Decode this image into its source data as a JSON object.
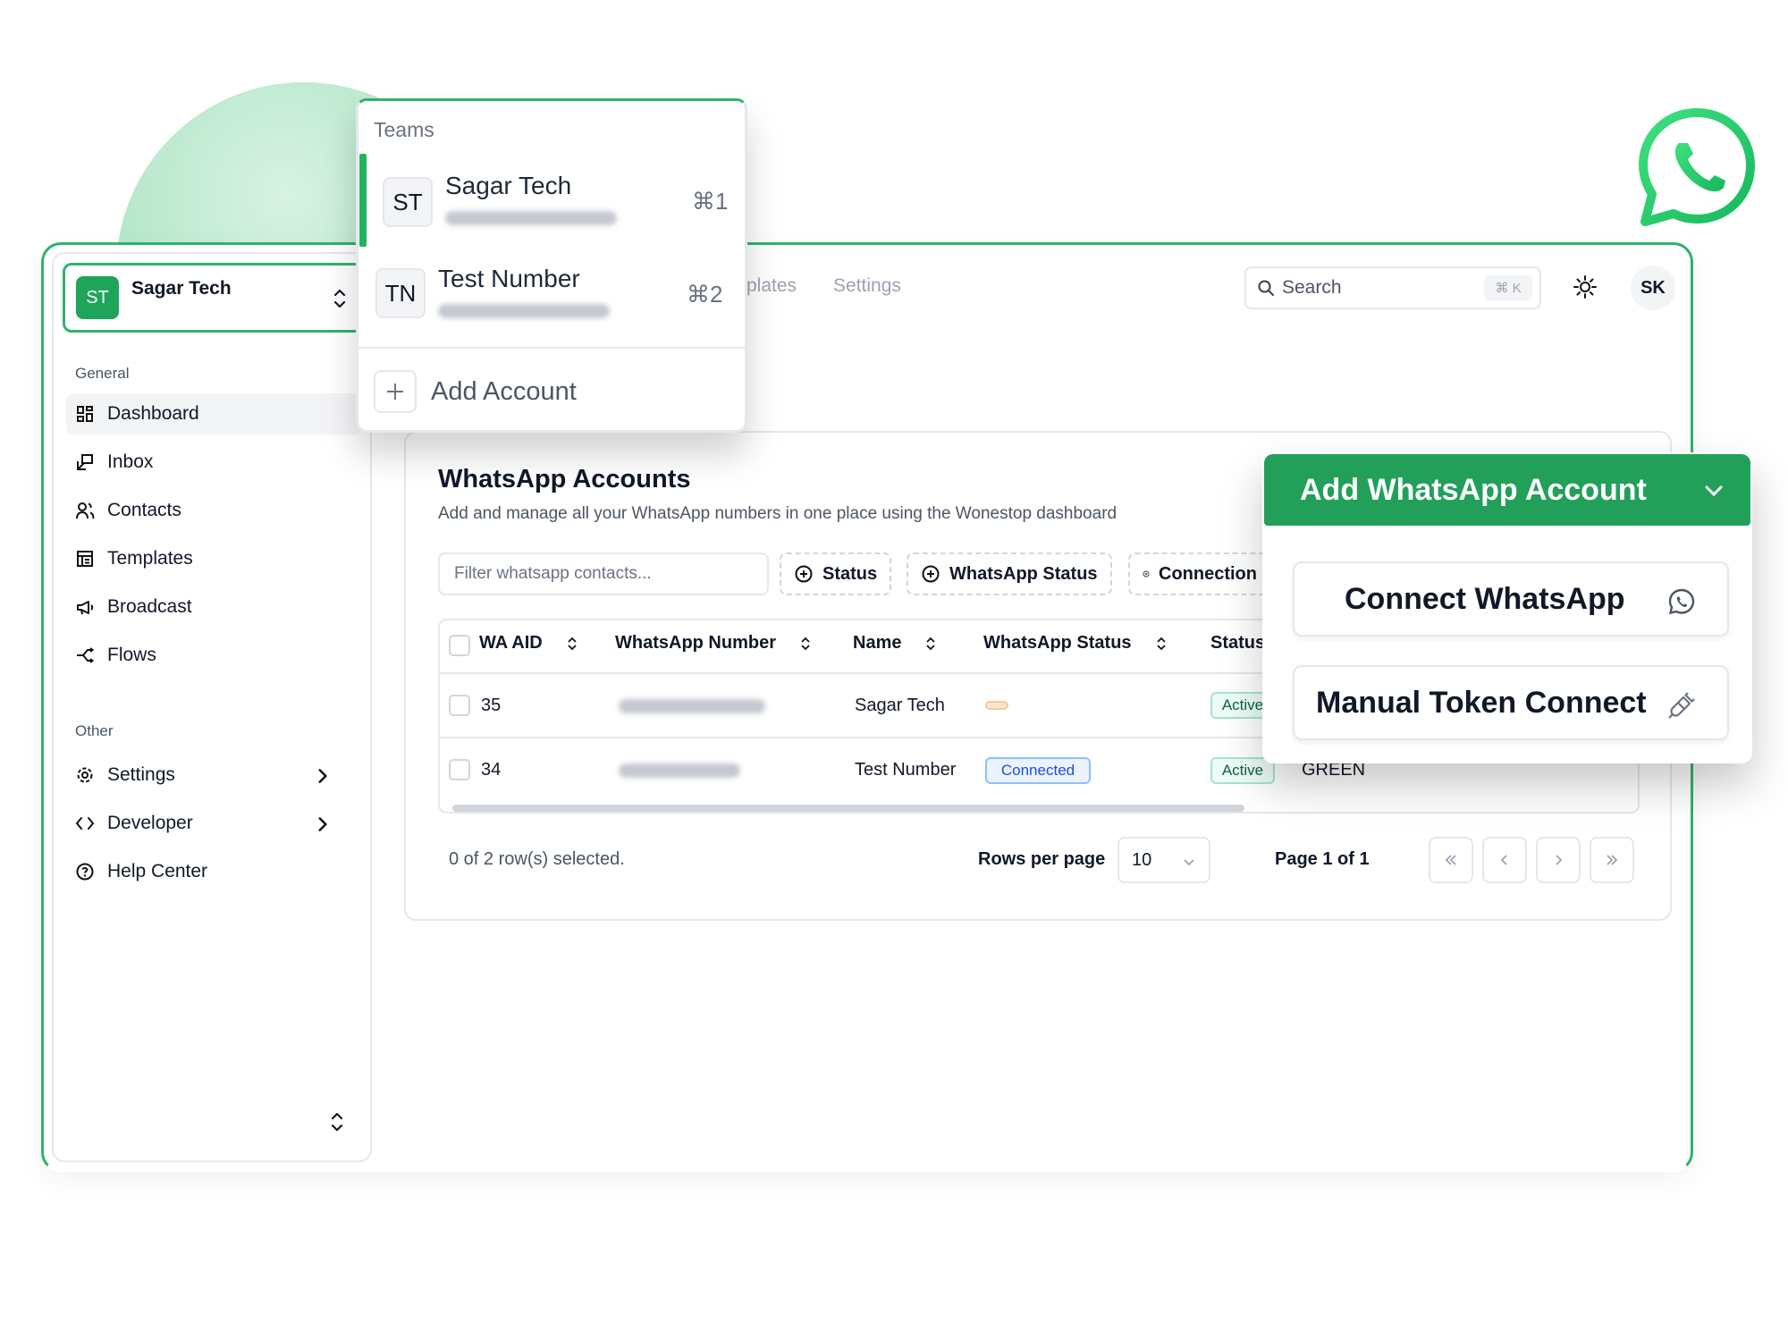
{
  "sidebar": {
    "team": {
      "initials": "ST",
      "name": "Sagar Tech"
    },
    "sections": {
      "general": "General",
      "other": "Other"
    },
    "items": [
      {
        "label": "Dashboard"
      },
      {
        "label": "Inbox"
      },
      {
        "label": "Contacts"
      },
      {
        "label": "Templates"
      },
      {
        "label": "Broadcast"
      },
      {
        "label": "Flows"
      },
      {
        "label": "Settings"
      },
      {
        "label": "Developer"
      },
      {
        "label": "Help Center"
      }
    ]
  },
  "topnav": {
    "tabs": [
      "plates",
      "Settings"
    ],
    "search": {
      "placeholder": "Search",
      "shortcut": "⌘ K"
    },
    "user_initials": "SK"
  },
  "teams_popover": {
    "label": "Teams",
    "teams": [
      {
        "initials": "ST",
        "name": "Sagar Tech",
        "shortcut": "⌘1"
      },
      {
        "initials": "TN",
        "name": "Test Number",
        "shortcut": "⌘2"
      }
    ],
    "add_account": "Add Account"
  },
  "main": {
    "title": "WhatsApp Accounts",
    "description": "Add and manage all your WhatsApp numbers in one place using the Wonestop dashboard",
    "filter_placeholder": "Filter whatsapp contacts...",
    "filter_buttons": [
      "Status",
      "WhatsApp Status",
      "Connection"
    ],
    "table": {
      "columns": [
        "WA AID",
        "WhatsApp Number",
        "Name",
        "WhatsApp Status",
        "Status"
      ],
      "rows": [
        {
          "wa_aid": "35",
          "name": "Sagar Tech",
          "whatsapp_status": "",
          "status": "Active"
        },
        {
          "wa_aid": "34",
          "name": "Test Number",
          "whatsapp_status": "Connected",
          "status": "Active",
          "quality": "GREEN"
        }
      ]
    },
    "footer": {
      "selection": "0 of 2 row(s) selected.",
      "rows_per_page_label": "Rows per page",
      "rows_per_page": "10",
      "page": "Page 1 of 1"
    }
  },
  "wa_dropdown": {
    "header": "Add WhatsApp Account",
    "options": [
      "Connect WhatsApp",
      "Manual Token Connect"
    ]
  },
  "colors": {
    "brand_green": "#22a05a",
    "accent_border": "#2fb36b"
  }
}
